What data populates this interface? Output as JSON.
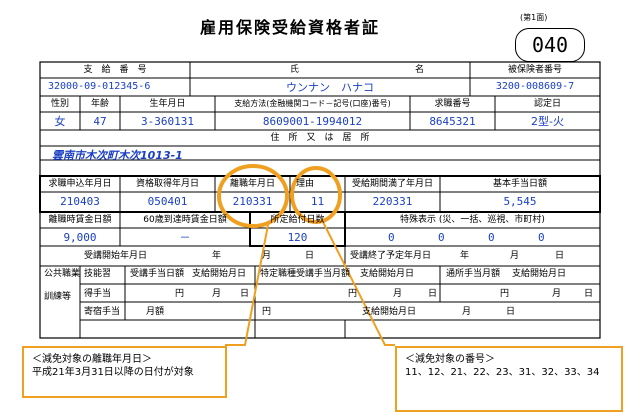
{
  "title": "雇用保険受給資格者証",
  "page_label": "(第1面)",
  "page_number": "040",
  "row1": {
    "h_payment_no": "支　給　番　号",
    "h_name": "氏",
    "h_name2": "名",
    "h_insured_no": "被保険者番号",
    "v_payment_no": "32000-09-012345-6",
    "v_name": "ウンナン　ハナコ",
    "v_insured_no": "3200-008609-7"
  },
  "row2": {
    "h_gender": "性別",
    "h_age": "年齢",
    "h_birth": "生年月日",
    "h_method": "支給方法(金融機関コード－記号(口座)番号)",
    "h_job_no": "求職番号",
    "h_cert_day": "認定日",
    "v_gender": "女",
    "v_age": "47",
    "v_birth": "3-360131",
    "v_method": "8609001-1994012",
    "v_job_no": "8645321",
    "v_cert_day": "2型-火"
  },
  "row3": {
    "h_address": "住　所　又　は　居　所",
    "v_address": "雲南市木次町木次1013-1"
  },
  "row4": {
    "h_apply_date": "求職申込年月日",
    "h_acquire_date": "資格取得年月日",
    "h_leave_date": "離職年月日",
    "h_reason": "理由",
    "h_period_end": "受給期間満了年月日",
    "h_daily_base": "基本手当日額",
    "v_apply_date": "210403",
    "v_acquire_date": "050401",
    "v_leave_date": "210331",
    "v_reason": "11",
    "v_period_end": "220331",
    "v_daily_base": "5,545"
  },
  "row5": {
    "h_wage": "離職時賃金日額",
    "h_wage60": "60歳到達時賃金日額",
    "h_days": "所定給付日数",
    "h_special": "特殊表示 (災、一括、巡視、市町村)",
    "v_wage": "9,000",
    "v_wage60": "－",
    "v_days": "120",
    "v_special": [
      "0",
      "0",
      "0",
      "0"
    ]
  },
  "row6": {
    "h_start": "受講開始年月日",
    "h_ym": "年",
    "h_m": "月",
    "h_d": "日",
    "h_end": "受講終了予定年月日",
    "h_ym2": "年",
    "h_m2": "月",
    "h_d2": "日"
  },
  "training": {
    "label1": "公共職業",
    "label2": "訓練等",
    "r1_a": "技能習",
    "r1_b": "受講手当日額",
    "r1_c": "支給開始月日",
    "r1_d": "特定職種受講手当月額",
    "r1_e": "支給開始月日",
    "r1_f": "通所手当月額",
    "r1_g": "支給開始月日",
    "r2_a": "得手当",
    "r2_yen": "円",
    "r2_m": "月",
    "r2_d": "日",
    "r3_a": "寄宿手当",
    "r3_b": "月額",
    "r3_c": "円",
    "r3_d": "支給開始月日",
    "r3_m": "月",
    "r3_dd": "日"
  },
  "notes": {
    "leave_title": "＜減免対象の離職年月日＞",
    "leave_body": "平成21年3月31日以降の日付が対象",
    "reason_title": "＜減免対象の番号＞",
    "reason_body": "11、12、21、22、23、31、32、33、34"
  },
  "colors": {
    "highlight": "#f0a020",
    "value": "#1a3fc4"
  }
}
